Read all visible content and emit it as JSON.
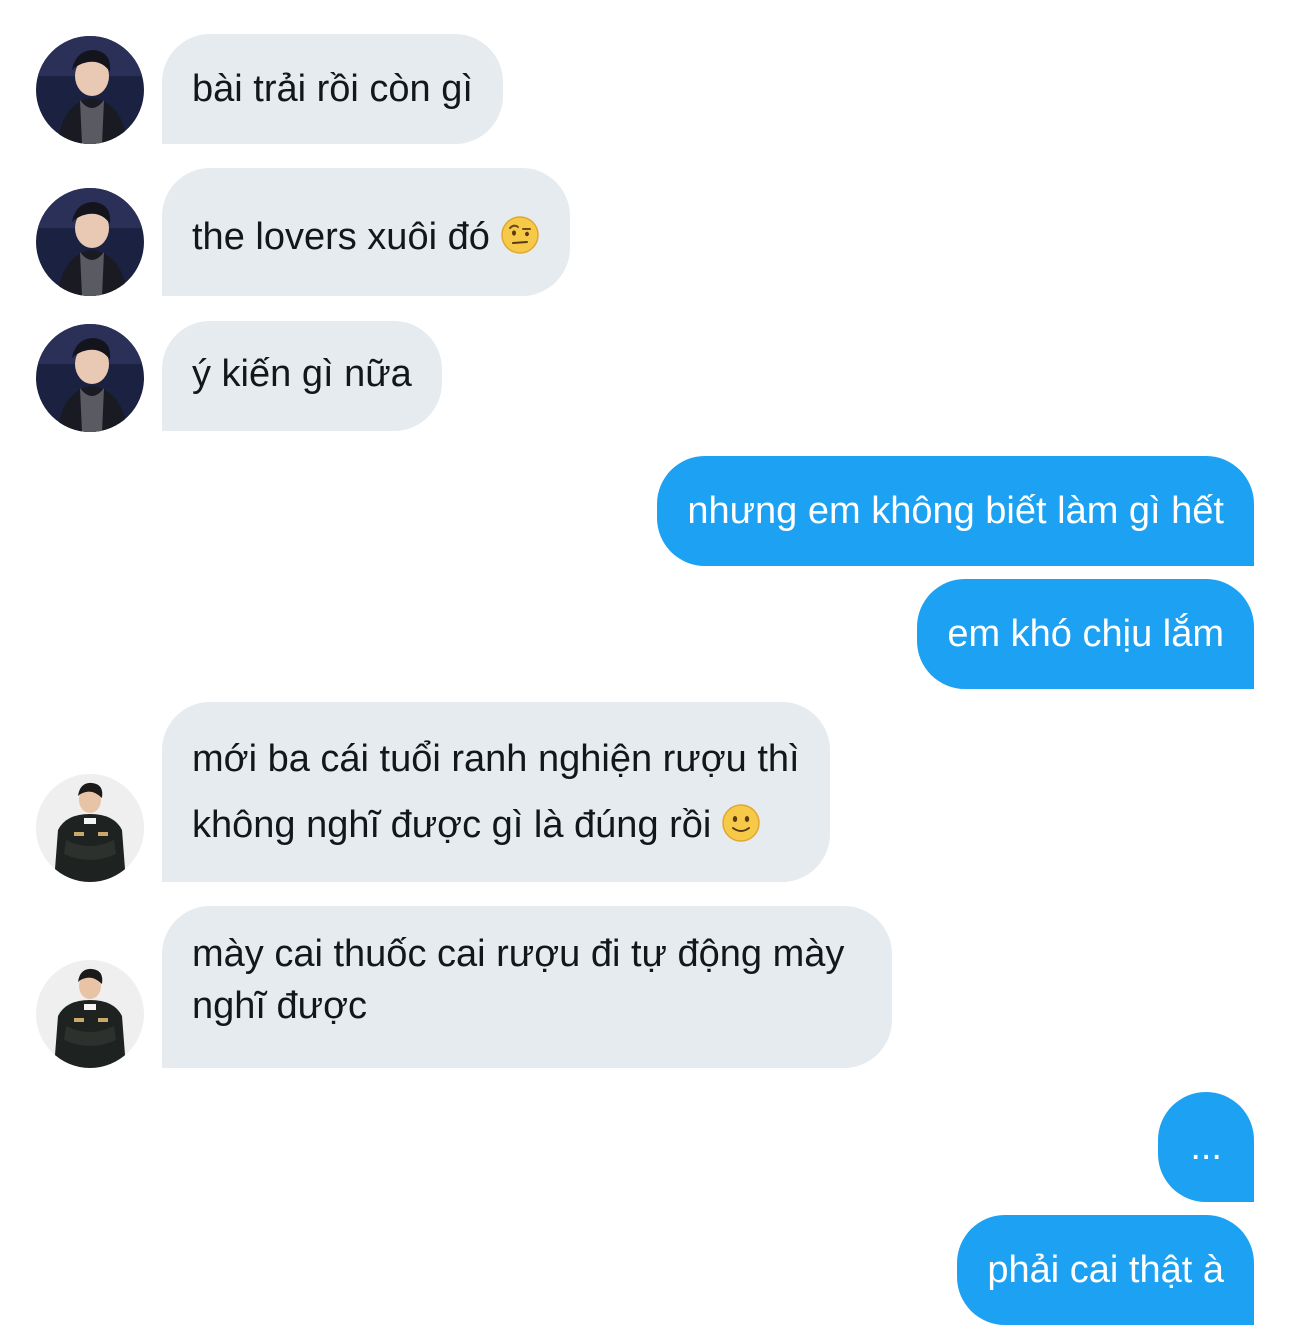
{
  "conversation": {
    "messages": [
      {
        "sender": "them",
        "avatar": "avatar-boy-suit",
        "text": "bài trải rồi còn gì"
      },
      {
        "sender": "them",
        "avatar": "avatar-boy-suit",
        "text": "the lovers xuôi đó",
        "emoji": "face-with-raised-eyebrow-icon"
      },
      {
        "sender": "them",
        "avatar": "avatar-boy-suit",
        "text": "ý kiến gì nữa"
      },
      {
        "sender": "me",
        "text": "nhưng em không biết làm gì hết"
      },
      {
        "sender": "me",
        "text": "em khó chịu lắm"
      },
      {
        "sender": "them",
        "avatar": "avatar-jacket-guy",
        "lines": [
          "mới ba cái tuổi ranh nghiện rượu thì",
          "không nghĩ được gì là đúng rồi"
        ],
        "emoji": "slightly-smiling-face-icon"
      },
      {
        "sender": "them",
        "avatar": "avatar-jacket-guy",
        "lines": [
          "mày cai thuốc cai rượu đi tự động mày",
          "nghĩ được"
        ]
      },
      {
        "sender": "me",
        "text": "..."
      },
      {
        "sender": "me",
        "text": "phải cai thật à"
      }
    ]
  },
  "colors": {
    "incoming_bubble": "#e6ebef",
    "outgoing_bubble": "#1da1f2",
    "incoming_text": "#14171a",
    "outgoing_text": "#ffffff"
  }
}
